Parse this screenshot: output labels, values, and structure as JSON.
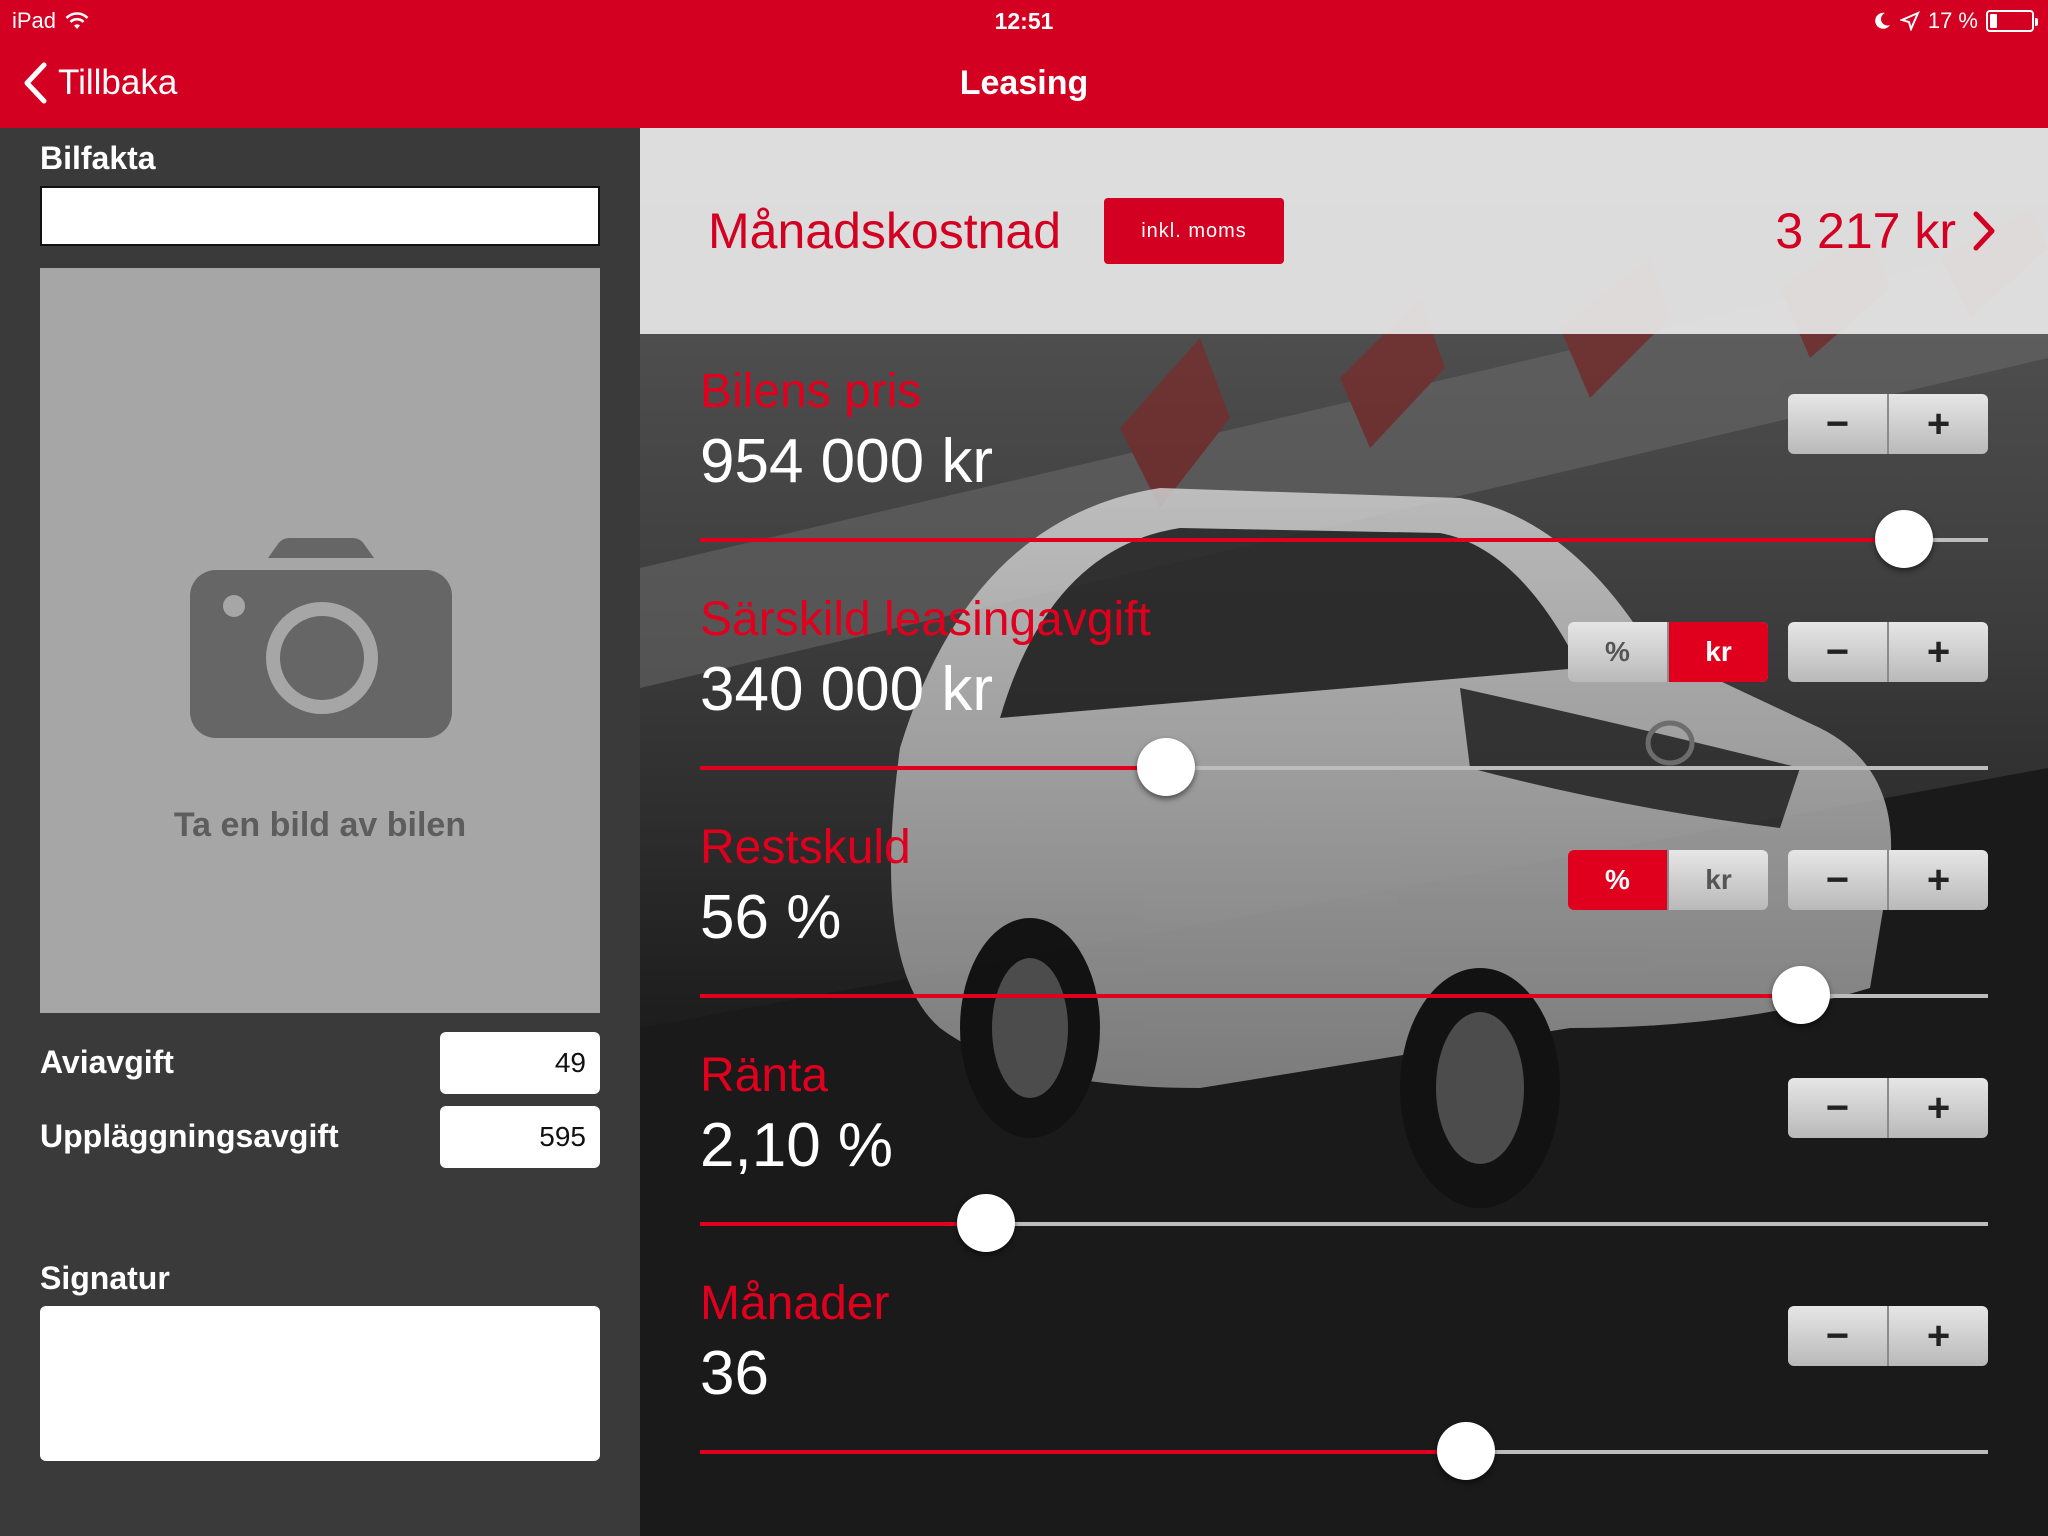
{
  "status_bar": {
    "carrier": "iPad",
    "time": "12:51",
    "battery": "17 %"
  },
  "nav": {
    "back_label": "Tillbaka",
    "title": "Leasing"
  },
  "left": {
    "bilfakta_label": "Bilfakta",
    "photo_prompt": "Ta en bild av bilen",
    "aviavgift_label": "Aviavgift",
    "aviavgift_value": "49",
    "upplaggning_label": "Uppläggningsavgift",
    "upplaggning_value": "595",
    "signatur_label": "Signatur"
  },
  "summary": {
    "title": "Månadskostnad",
    "moms_label": "inkl. moms",
    "value": "3 217 kr"
  },
  "stepper": {
    "minus": "−",
    "plus": "+"
  },
  "rows": [
    {
      "label": "Bilens pris",
      "value": "954 000 kr",
      "slider": 0.935
    },
    {
      "label": "Särskild leasingavgift",
      "value": "340 000 kr",
      "slider": 0.362,
      "seg": [
        "%",
        "kr"
      ],
      "seg_active": 1
    },
    {
      "label": "Restskuld",
      "value": "56 %",
      "slider": 0.855,
      "seg": [
        "%",
        "kr"
      ],
      "seg_active": 0
    },
    {
      "label": "Ränta",
      "value": "2,10 %",
      "slider": 0.222
    },
    {
      "label": "Månader",
      "value": "36",
      "slider": 595
    }
  ],
  "colors": {
    "accent": "#d40021",
    "panel": "#3a3a3a"
  }
}
